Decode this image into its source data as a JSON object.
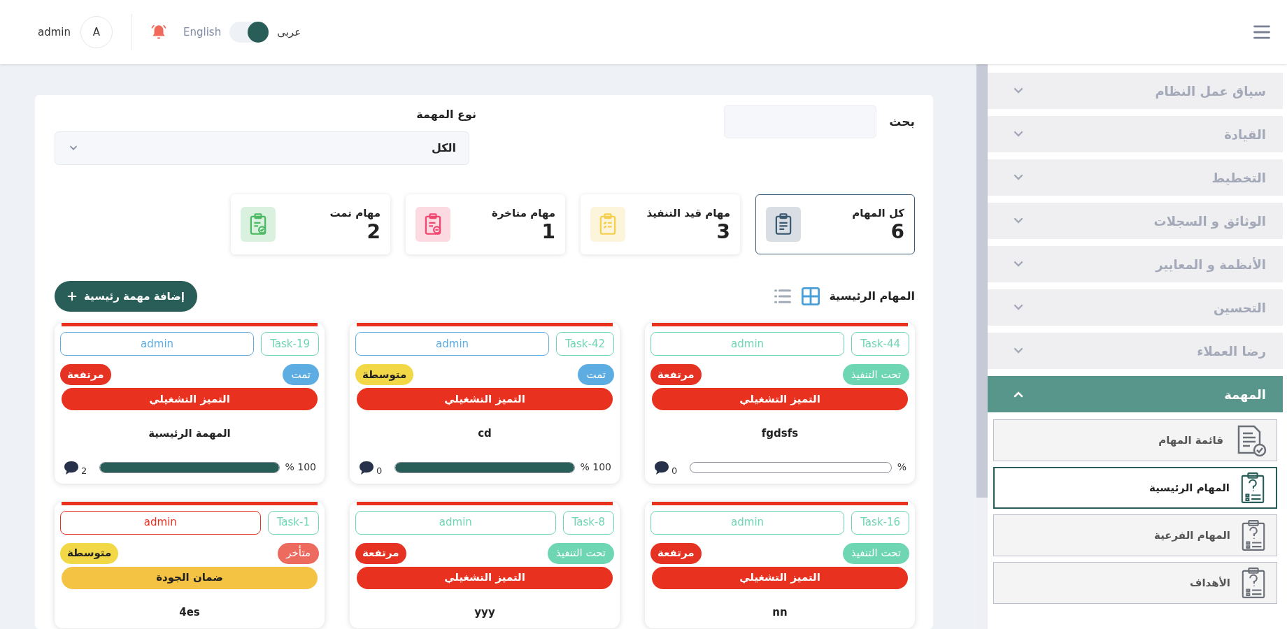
{
  "header": {
    "user": "admin",
    "avatar_letter": "A",
    "language_toggle": {
      "left_label": "English",
      "right_label": "عربى",
      "on": true
    }
  },
  "filters": {
    "search": {
      "label": "بحث"
    },
    "task_type": {
      "label": "نوع المهمة",
      "value": "الكل"
    }
  },
  "stats": [
    {
      "label": "كل المهام",
      "count": "6",
      "selected": true,
      "color": "#3d5a73"
    },
    {
      "label": "مهام قيد التنفيذ",
      "count": "3",
      "selected": false,
      "color": "#f3cf4d"
    },
    {
      "label": "مهام متاخرة",
      "count": "1",
      "selected": false,
      "color": "#ef476f"
    },
    {
      "label": "مهام تمت",
      "count": "2",
      "selected": false,
      "color": "#4cb963"
    }
  ],
  "section": {
    "title": "المهام الرئيسية",
    "view_toggles": [
      {
        "kind": "grid",
        "selected": true
      },
      {
        "kind": "list",
        "selected": false
      }
    ],
    "add_button": "إضافة مهمة رئيسية"
  },
  "tasks": [
    {
      "code": "Task-44",
      "owner": {
        "text": "admin",
        "color": "#6fd6b4"
      },
      "status": {
        "text": "تحت التنفيذ",
        "color": "#6fd6b4"
      },
      "priority": {
        "text": "مرتفعة",
        "color": "#e63222"
      },
      "category": {
        "text": "التميز التشغيلي",
        "color": "#e8321f"
      },
      "name": "fgdsfs",
      "progress": {
        "level": 0,
        "reading": "%"
      },
      "comments": "0"
    },
    {
      "code": "Task-42",
      "owner": {
        "text": "admin",
        "color": "#5dade2"
      },
      "status": {
        "text": "تمت",
        "color": "#5dade2"
      },
      "priority": {
        "text": "متوسطة",
        "color": "#f2d846"
      },
      "category": {
        "text": "التميز التشغيلي",
        "color": "#e8321f"
      },
      "name": "cd",
      "progress": {
        "level": 1,
        "reading": "100 %"
      },
      "comments": "0"
    },
    {
      "code": "Task-19",
      "owner": {
        "text": "admin",
        "color": "#5dade2"
      },
      "status": {
        "text": "تمت",
        "color": "#5dade2"
      },
      "priority": {
        "text": "مرتفعة",
        "color": "#e63222"
      },
      "category": {
        "text": "التميز التشغيلي",
        "color": "#e8321f"
      },
      "name": "المهمة الرئيسية",
      "progress": {
        "level": 1,
        "reading": "100 %"
      },
      "comments": "2"
    },
    {
      "code": "Task-16",
      "owner": {
        "text": "admin",
        "color": "#6fd6b4"
      },
      "status": {
        "text": "تحت التنفيذ",
        "color": "#6fd6b4"
      },
      "priority": {
        "text": "مرتفعة",
        "color": "#e63222"
      },
      "category": {
        "text": "التميز التشغيلي",
        "color": "#e8321f"
      },
      "name": "nn"
    },
    {
      "code": "Task-8",
      "owner": {
        "text": "admin",
        "color": "#6fd6b4"
      },
      "status": {
        "text": "تحت التنفيذ",
        "color": "#6fd6b4"
      },
      "priority": {
        "text": "مرتفعة",
        "color": "#e63222"
      },
      "category": {
        "text": "التميز التشغيلي",
        "color": "#e8321f"
      },
      "name": "yyy"
    },
    {
      "code": "Task-1",
      "owner": {
        "text": "admin",
        "color": "#e8321f"
      },
      "status": {
        "text": "متأخر",
        "color": "#ec6a5e"
      },
      "priority": {
        "text": "متوسطة",
        "color": "#f2d846"
      },
      "category": {
        "text": "ضمان الجودة",
        "color": "#f5c343"
      },
      "name": "4es"
    }
  ],
  "sidebar": {
    "items": [
      {
        "label": "سياق عمل النظام",
        "expanded": false
      },
      {
        "label": "القيادة",
        "expanded": false
      },
      {
        "label": "التخطيط",
        "expanded": false
      },
      {
        "label": "الوثائق و السجلات",
        "expanded": false
      },
      {
        "label": "الأنظمة و المعايير",
        "expanded": false
      },
      {
        "label": "التحسين",
        "expanded": false
      },
      {
        "label": "رضا العملاء",
        "expanded": false
      },
      {
        "label": "المهمة",
        "expanded": true,
        "children": [
          {
            "label": "قائمة المهام",
            "kind": "list",
            "selected": false
          },
          {
            "label": "المهام الرئيسية",
            "kind": "question",
            "selected": true
          },
          {
            "label": "المهام الفرعية",
            "kind": "question",
            "selected": false
          },
          {
            "label": "الأهداف",
            "kind": "question",
            "selected": false
          }
        ]
      }
    ]
  }
}
